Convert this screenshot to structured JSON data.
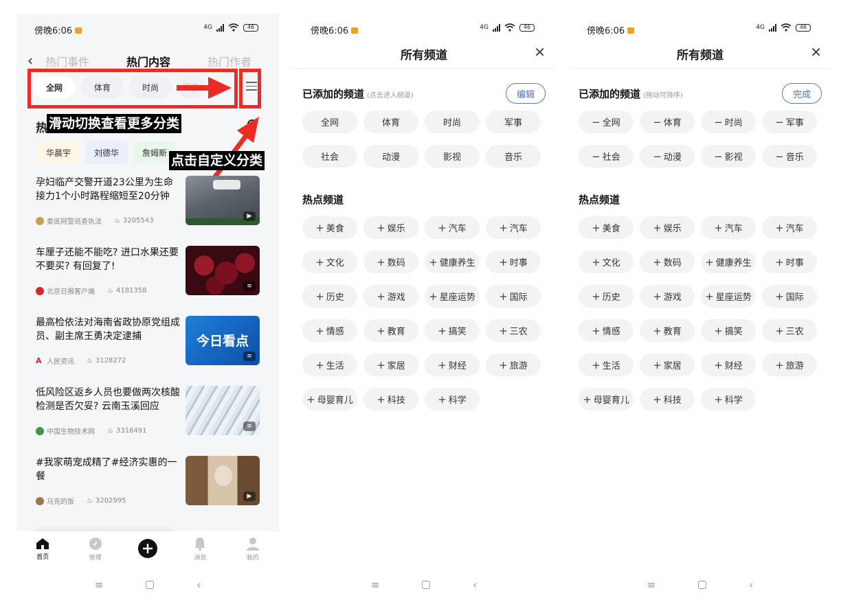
{
  "status": {
    "time": "傍晚6:06",
    "battery": "46",
    "network": "4G"
  },
  "home": {
    "back": "‹",
    "tabs": [
      "热门事件",
      "热门内容",
      "热门作者"
    ],
    "chips": [
      "全网",
      "体育",
      "时尚",
      "军事"
    ],
    "callout_swipe": "滑动切换查看更多分类",
    "callout_tap": "点击自定义分类",
    "hot_title": "热",
    "tags": [
      "华晨宇",
      "刘德华",
      "詹姆斯"
    ],
    "news": [
      {
        "title": "孕妇临产交警开道23公里为生命接力1个小时路程缩短至20分钟",
        "source": "娄底网警巡查执法",
        "count": "3205543"
      },
      {
        "title": "车厘子还能不能吃? 进口水果还要不要买? 有回复了!",
        "source": "北京日报客户端",
        "count": "4181358"
      },
      {
        "title": "最高检依法对海南省政协原党组成员、副主席王勇决定逮捕",
        "source": "人民资讯",
        "count": "3128272",
        "thumb_text": "今日看点"
      },
      {
        "title": "低风险区返乡人员也要做两次核酸检测是否欠妥? 云南玉溪回应",
        "source": "中国生物技术网",
        "count": "3318491"
      },
      {
        "title": "#我家萌宠成精了#经济实惠的一餐",
        "source": "马克的饭",
        "count": "3202995"
      }
    ],
    "nav": [
      "首页",
      "管理",
      "",
      "消息",
      "我的"
    ]
  },
  "channels_view": {
    "title": "所有频道",
    "added_title": "已添加的频道",
    "added_hint": "(点击进入频道)",
    "edit_label": "编辑"
  },
  "channels_edit": {
    "title": "所有频道",
    "added_title": "已添加的频道",
    "added_hint": "(拖动可排序)",
    "done_label": "完成"
  },
  "added_channels": [
    "全网",
    "体育",
    "时尚",
    "军事",
    "社会",
    "动漫",
    "影视",
    "音乐"
  ],
  "hot_title": "热点频道",
  "hot_channels": [
    "美食",
    "娱乐",
    "汽车",
    "汽车",
    "文化",
    "数码",
    "健康养生",
    "时事",
    "历史",
    "游戏",
    "星座运势",
    "国际",
    "情感",
    "教育",
    "搞笑",
    "三农",
    "生活",
    "家居",
    "财经",
    "旅游",
    "母婴育儿",
    "科技",
    "科学"
  ],
  "symbols": {
    "add": "+",
    "remove": "−"
  },
  "colors": {
    "accent_red": "#ee2a24",
    "edit_blue": "#4a6fd2"
  }
}
